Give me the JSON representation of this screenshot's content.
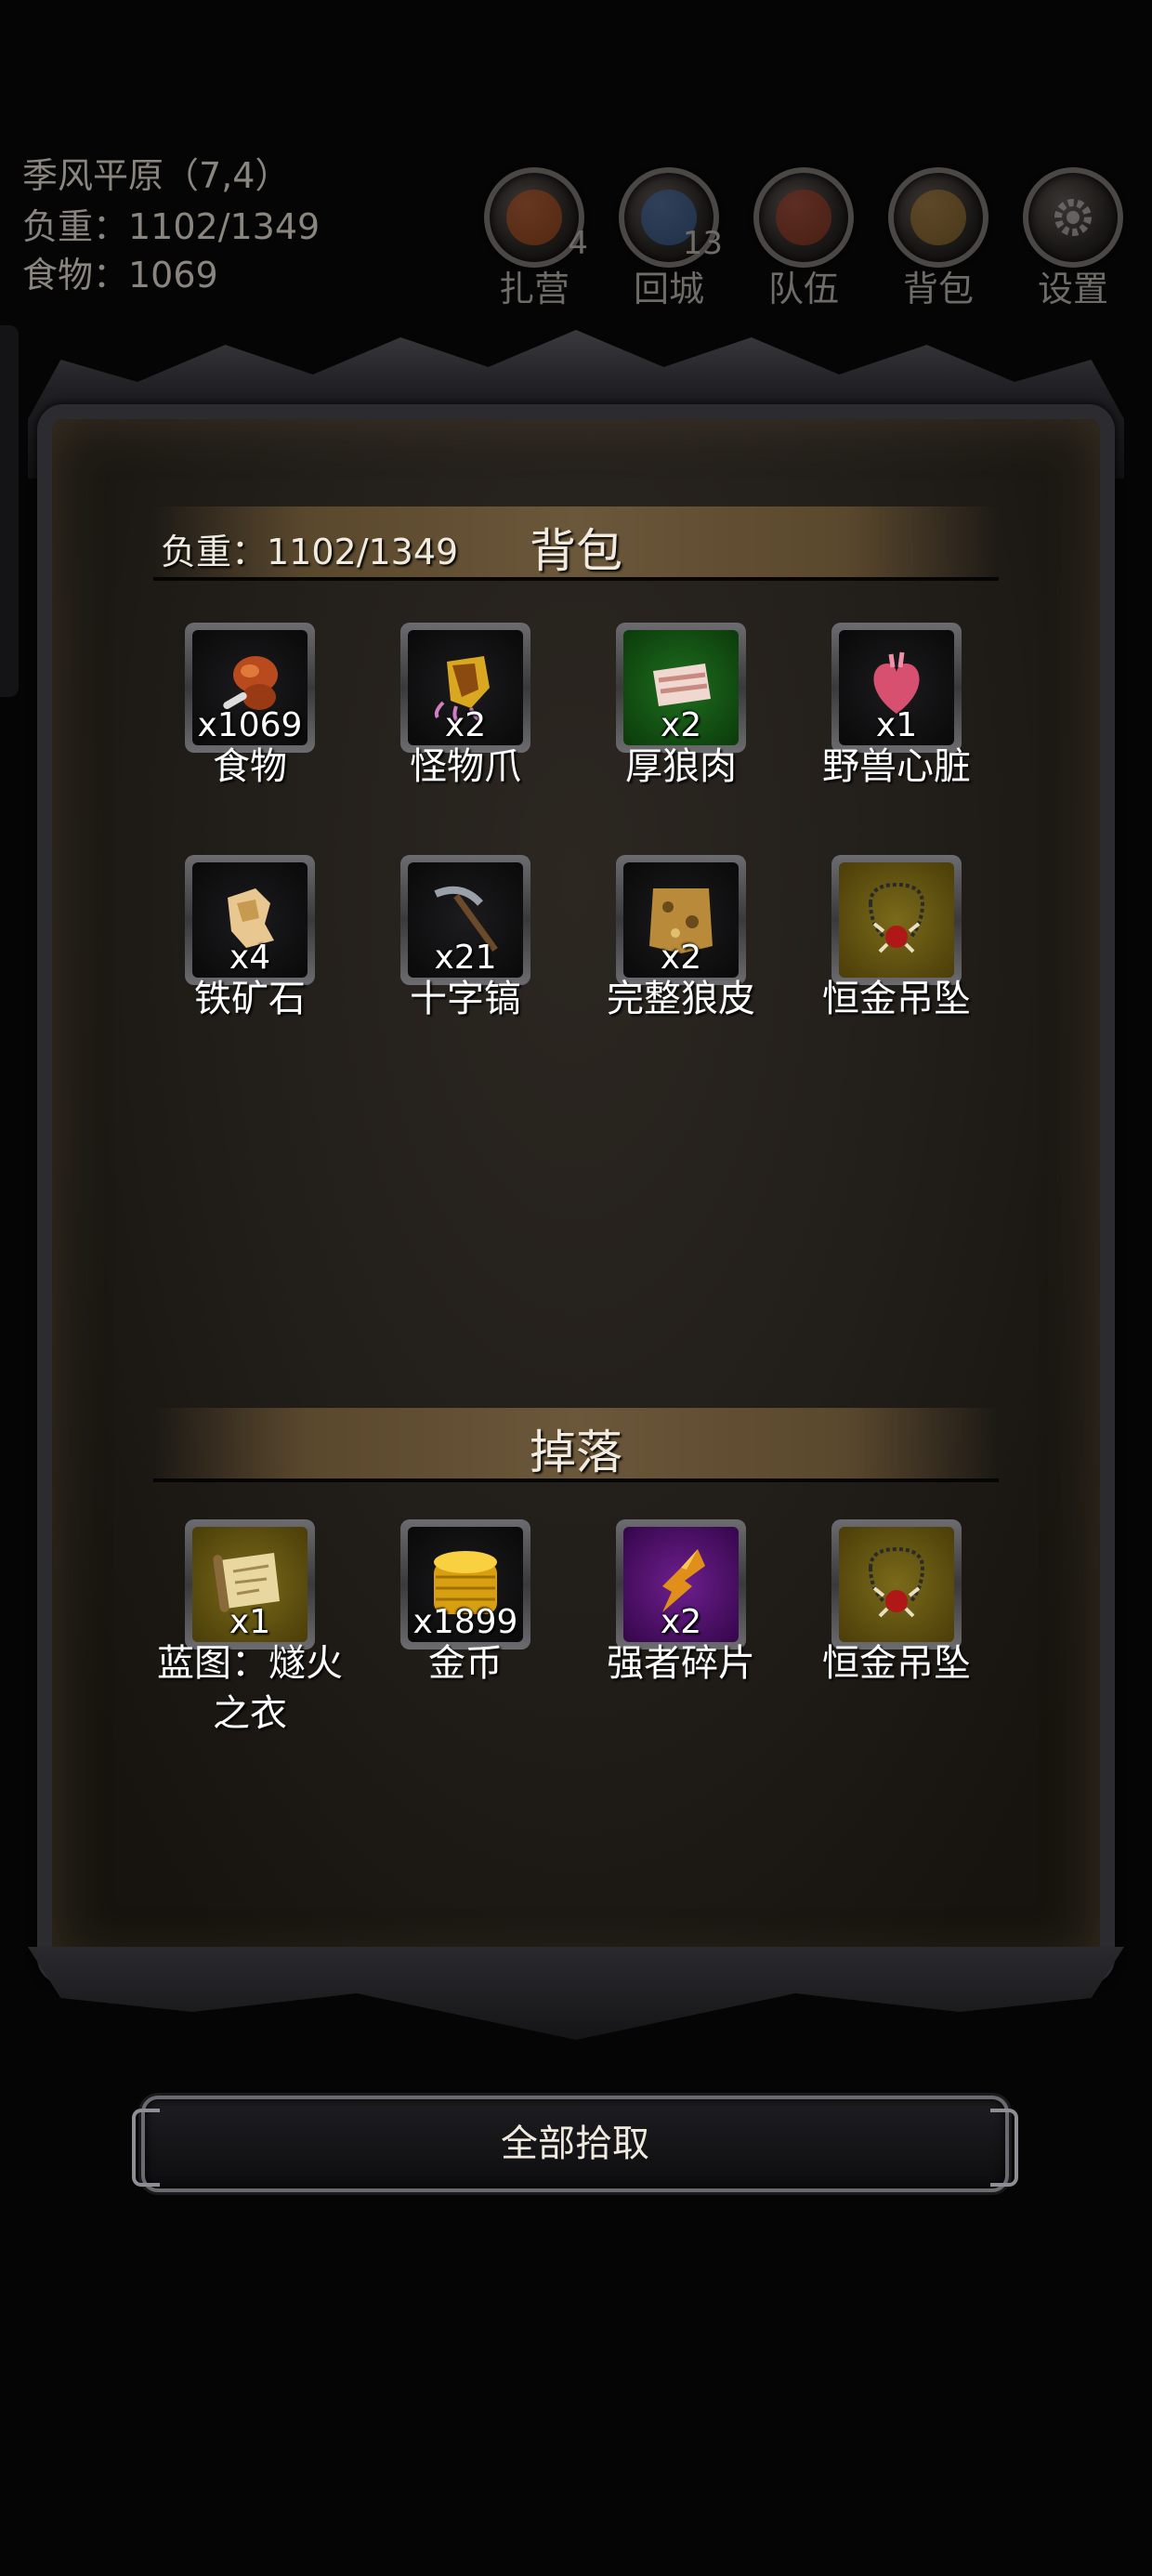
{
  "status": {
    "location": "季风平原（7,4）",
    "load": "负重：1102/1349",
    "food": "食物：1069"
  },
  "menu": [
    {
      "label": "扎营",
      "badge": "4",
      "icon": "campfire-icon",
      "color": "#8a3a14"
    },
    {
      "label": "回城",
      "badge": "13",
      "icon": "portal-icon",
      "color": "#2a4a7a"
    },
    {
      "label": "队伍",
      "badge": "",
      "icon": "team-banner-icon",
      "color": "#7a2a18"
    },
    {
      "label": "背包",
      "badge": "",
      "icon": "barrel-icon",
      "color": "#7a5a20"
    },
    {
      "label": "设置",
      "badge": "",
      "icon": "gear-icon",
      "color": "#5a5a5a"
    }
  ],
  "backpack": {
    "title": "背包",
    "load": "负重：1102/1349",
    "items": [
      {
        "name": "食物",
        "qty": "x1069",
        "rarity": "gray",
        "icon": "meat-leg-icon"
      },
      {
        "name": "怪物爪",
        "qty": "x2",
        "rarity": "gray",
        "icon": "claw-icon"
      },
      {
        "name": "厚狼肉",
        "qty": "x2",
        "rarity": "green",
        "icon": "wolf-meat-icon"
      },
      {
        "name": "野兽心脏",
        "qty": "x1",
        "rarity": "gray",
        "icon": "heart-icon"
      },
      {
        "name": "铁矿石",
        "qty": "x4",
        "rarity": "gray",
        "icon": "iron-ore-icon"
      },
      {
        "name": "十字镐",
        "qty": "x21",
        "rarity": "gray",
        "icon": "pickaxe-icon"
      },
      {
        "name": "完整狼皮",
        "qty": "x2",
        "rarity": "gray",
        "icon": "wolf-pelt-icon"
      },
      {
        "name": "恒金吊坠",
        "qty": "",
        "rarity": "gold",
        "icon": "pendant-icon"
      }
    ]
  },
  "drops": {
    "title": "掉落",
    "items": [
      {
        "name": "蓝图：燧火之衣",
        "qty": "x1",
        "rarity": "gold",
        "icon": "blueprint-scroll-icon"
      },
      {
        "name": "金币",
        "qty": "x1899",
        "rarity": "gray",
        "icon": "gold-coins-icon"
      },
      {
        "name": "强者碎片",
        "qty": "x2",
        "rarity": "purple",
        "icon": "shard-icon"
      },
      {
        "name": "恒金吊坠",
        "qty": "",
        "rarity": "gold",
        "icon": "pendant-icon"
      }
    ]
  },
  "pickup_all_label": "全部拾取"
}
